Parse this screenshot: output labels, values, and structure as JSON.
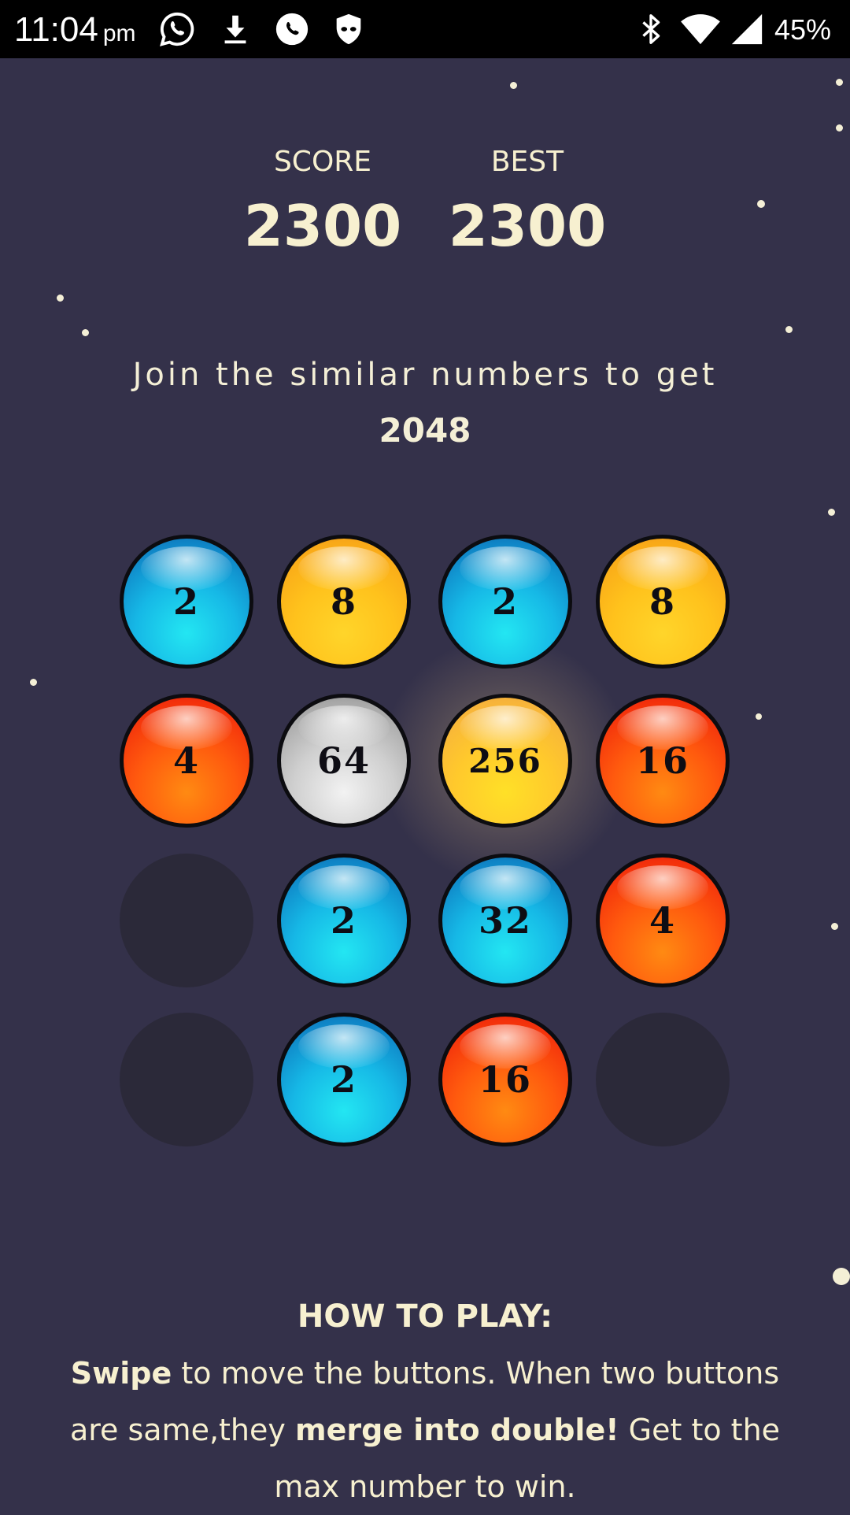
{
  "status_bar": {
    "time": "11:04",
    "ampm": "pm",
    "battery": "45%",
    "icons": [
      "whatsapp-icon",
      "download-icon",
      "phone-icon",
      "shield-icon",
      "bluetooth-icon",
      "wifi-icon",
      "signal-icon"
    ]
  },
  "header": {
    "score_label": "SCORE",
    "score_value": "2300",
    "best_label": "BEST",
    "best_value": "2300"
  },
  "tagline": {
    "line1": "Join the similar numbers to get",
    "target": "2048"
  },
  "board": {
    "rows": [
      [
        {
          "value": "2",
          "color": "blue"
        },
        {
          "value": "8",
          "color": "yellow"
        },
        {
          "value": "2",
          "color": "blue"
        },
        {
          "value": "8",
          "color": "yellow"
        }
      ],
      [
        {
          "value": "4",
          "color": "red"
        },
        {
          "value": "64",
          "color": "silver"
        },
        {
          "value": "256",
          "color": "gold"
        },
        {
          "value": "16",
          "color": "red"
        }
      ],
      [
        {
          "value": "",
          "color": "empty"
        },
        {
          "value": "2",
          "color": "blue"
        },
        {
          "value": "32",
          "color": "blue"
        },
        {
          "value": "4",
          "color": "red"
        }
      ],
      [
        {
          "value": "",
          "color": "empty"
        },
        {
          "value": "2",
          "color": "blue"
        },
        {
          "value": "16",
          "color": "red"
        },
        {
          "value": "",
          "color": "empty"
        }
      ]
    ],
    "colors": {
      "blue": "#16b8e6",
      "yellow": "#ffc21c",
      "red": "#ff5a0e",
      "silver": "#cfcfcf",
      "gold": "#ffc92c",
      "empty": "#2b2939",
      "background": "#34314a"
    }
  },
  "how_to_play": {
    "title": "HOW TO PLAY:",
    "swipe": "Swipe",
    "text1": " to move the buttons. When two buttons are same,they ",
    "merge": "merge into double!",
    "text2": " Get to the max number to win."
  }
}
